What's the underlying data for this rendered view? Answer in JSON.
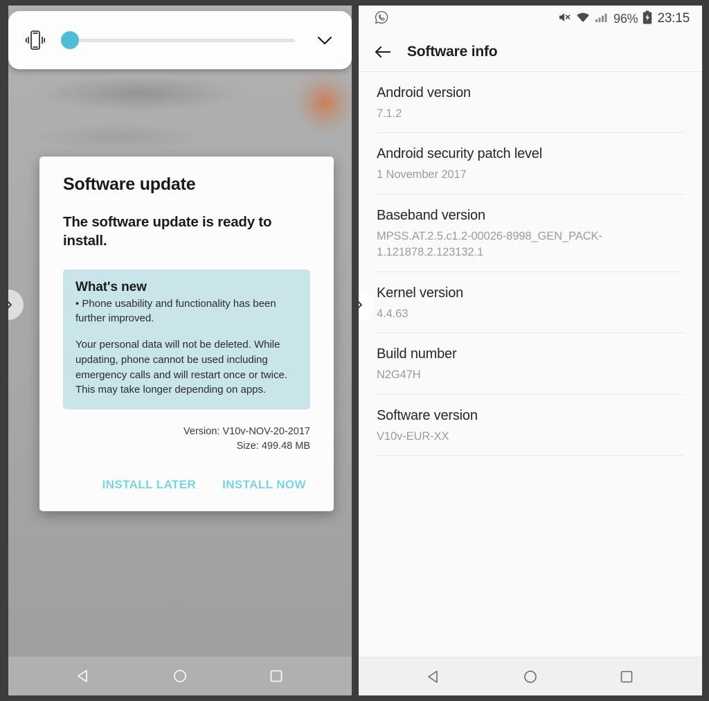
{
  "left_panel": {
    "quick_settings": {
      "vibrate_icon": "vibrate-icon",
      "slider_value_percent": 4,
      "expand_icon": "chevron-down-icon"
    },
    "dialog": {
      "title": "Software update",
      "subtitle": "The software update is ready to install.",
      "whats_new_title": "What's new",
      "whats_new_bullet": "• Phone usability and functionality has been further improved.",
      "whats_new_paragraph": "Your personal data will not be deleted. While updating, phone cannot be used including emergency calls and will restart once or twice. This may take longer depending on apps.",
      "version_line": "Version: V10v-NOV-20-2017",
      "size_line": "Size: 499.48 MB",
      "install_later_label": "INSTALL LATER",
      "install_now_label": "INSTALL NOW",
      "accent_color": "#7fd2dd",
      "whats_new_bg": "#cae5e9"
    },
    "nav_overlay_icon": "chevron-right-icon",
    "navbar": {
      "back_icon": "back-triangle-icon",
      "home_icon": "home-circle-icon",
      "recents_icon": "recents-square-icon"
    }
  },
  "right_panel": {
    "statusbar": {
      "app_icon": "whatsapp-icon",
      "mute_icon": "volume-muted-icon",
      "wifi_icon": "wifi-icon",
      "signal_icon": "cellular-signal-icon",
      "battery_percent": "96%",
      "battery_icon": "battery-charging-icon",
      "clock": "23:15"
    },
    "appbar": {
      "back_icon": "back-arrow-icon",
      "title": "Software info"
    },
    "info_rows": [
      {
        "label": "Android version",
        "value": "7.1.2"
      },
      {
        "label": "Android security patch level",
        "value": "1 November 2017"
      },
      {
        "label": "Baseband version",
        "value": "MPSS.AT.2.5.c1.2-00026-8998_GEN_PACK-1.121878.2.123132.1"
      },
      {
        "label": "Kernel version",
        "value": "4.4.63"
      },
      {
        "label": "Build number",
        "value": "N2G47H"
      },
      {
        "label": "Software version",
        "value": "V10v-EUR-XX"
      }
    ],
    "nav_overlay_icon": "chevron-right-icon",
    "navbar": {
      "back_icon": "back-triangle-icon",
      "home_icon": "home-circle-icon",
      "recents_icon": "recents-square-icon"
    }
  }
}
